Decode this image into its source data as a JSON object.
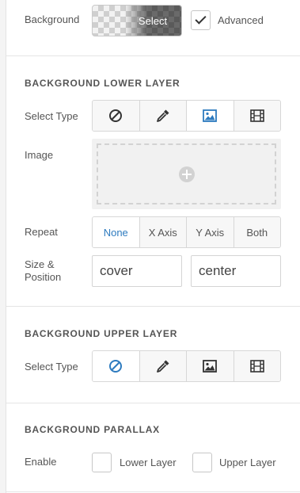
{
  "background": {
    "label": "Background",
    "select_label": "Select",
    "advanced_checked": true,
    "advanced_label": "Advanced"
  },
  "lower_layer": {
    "title": "BACKGROUND LOWER LAYER",
    "select_type_label": "Select Type",
    "type_options": [
      "none-icon",
      "eyedropper-icon",
      "image-icon",
      "film-icon"
    ],
    "active_type": "image-icon",
    "image_label": "Image",
    "repeat_label": "Repeat",
    "repeat_options": [
      "None",
      "X Axis",
      "Y Axis",
      "Both"
    ],
    "repeat_selected": "None",
    "size_position_label_line1": "Size &",
    "size_position_label_line2": "Position",
    "size_value": "cover",
    "position_value": "center"
  },
  "upper_layer": {
    "title": "BACKGROUND UPPER LAYER",
    "select_type_label": "Select Type",
    "type_options": [
      "none-icon",
      "eyedropper-icon",
      "image-icon",
      "film-icon"
    ],
    "active_type": "none-icon"
  },
  "parallax": {
    "title": "BACKGROUND PARALLAX",
    "enable_label": "Enable",
    "lower_layer_label": "Lower Layer",
    "lower_layer_checked": false,
    "upper_layer_label": "Upper Layer",
    "upper_layer_checked": false
  },
  "colors": {
    "accent": "#2e7bbf",
    "icon_default": "#333333"
  }
}
